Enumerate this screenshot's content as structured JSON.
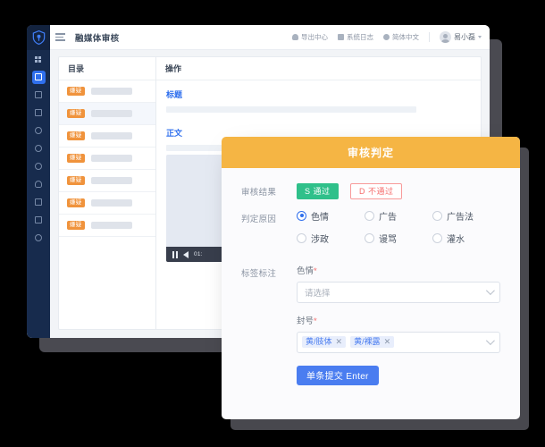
{
  "app": {
    "title": "融媒体审核",
    "menu_icon": "hamburger-icon",
    "bell_icon": "bell-icon"
  },
  "topbar": {
    "export_center": "导出中心",
    "system_log": "系统日志",
    "language": "简体中文",
    "user_name": "易小磊",
    "export_icon": "cloud-upload-icon",
    "log_icon": "document-icon",
    "lang_icon": "globe-icon",
    "avatar_icon": "user-avatar",
    "caret_icon": "chevron-down-icon"
  },
  "sidebar": {
    "logo_icon": "shield-logo",
    "items": [
      {
        "icon": "grid-icon",
        "active": false
      },
      {
        "icon": "review-icon",
        "active": true
      },
      {
        "icon": "message-icon",
        "active": false
      },
      {
        "icon": "archive-icon",
        "active": false
      },
      {
        "icon": "clock-icon",
        "active": false
      },
      {
        "icon": "pie-chart-icon",
        "active": false
      },
      {
        "icon": "target-icon",
        "active": false
      },
      {
        "icon": "user-icon",
        "active": false
      },
      {
        "icon": "lock-icon",
        "active": false
      },
      {
        "icon": "book-icon",
        "active": false
      },
      {
        "icon": "gear-icon",
        "active": false
      }
    ]
  },
  "table": {
    "col_directory": "目录",
    "col_operation": "操作",
    "rows": [
      {
        "badge": "嫌疑",
        "selected": false
      },
      {
        "badge": "嫌疑",
        "selected": true
      },
      {
        "badge": "嫌疑",
        "selected": false
      },
      {
        "badge": "嫌疑",
        "selected": false
      },
      {
        "badge": "嫌疑",
        "selected": false
      },
      {
        "badge": "嫌疑",
        "selected": false
      },
      {
        "badge": "嫌疑",
        "selected": false
      }
    ]
  },
  "detail": {
    "title_label": "标题",
    "body_label": "正文",
    "video": {
      "pause_icon": "pause-icon",
      "volume_icon": "volume-icon",
      "time": "01:"
    }
  },
  "modal": {
    "header": "审核判定",
    "result": {
      "label": "审核结果",
      "pass": "S 通过",
      "fail": "D 不通过"
    },
    "reason": {
      "label": "判定原因",
      "options": [
        {
          "text": "色情",
          "selected": true
        },
        {
          "text": "广告",
          "selected": false
        },
        {
          "text": "广告法",
          "selected": false
        },
        {
          "text": "涉政",
          "selected": false
        },
        {
          "text": "谩骂",
          "selected": false
        },
        {
          "text": "灌水",
          "selected": false
        }
      ]
    },
    "tagging": {
      "label": "标签标注",
      "field1_label": "色情",
      "field1_required": "*",
      "field1_placeholder": "请选择",
      "field2_label": "封号",
      "field2_required": "*",
      "tags": [
        "黄/肢体",
        "黄/裸露"
      ],
      "remove_icon": "close-icon",
      "chevron_icon": "chevron-down-icon"
    },
    "submit": "单条提交 Enter"
  },
  "colors": {
    "accent_orange": "#f5b544",
    "badge_orange": "#f0933c",
    "pass_green": "#2fc08a",
    "fail_red": "#f56c6c",
    "primary_blue": "#4a7df0",
    "rail_dark": "#172b4d"
  }
}
